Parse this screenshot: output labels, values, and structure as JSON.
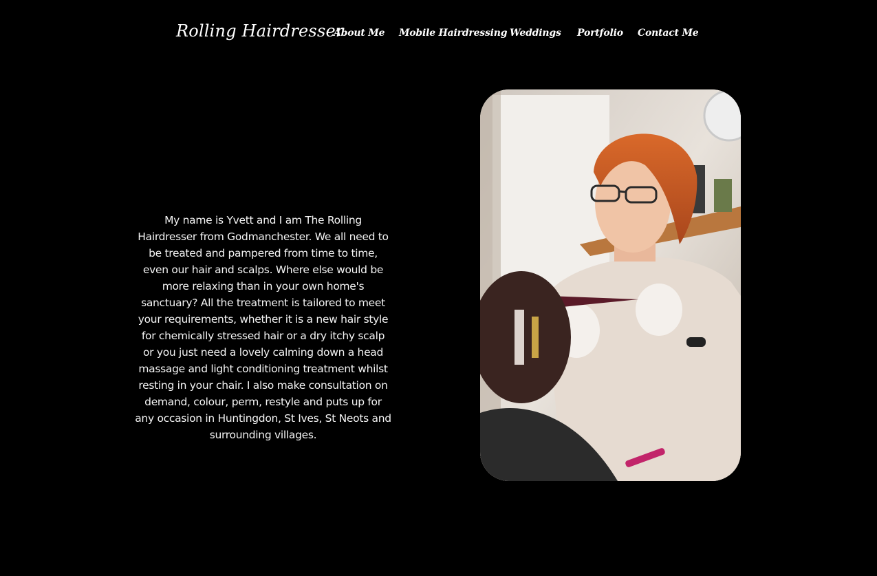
{
  "header": {
    "logo_text": "Rolling Hairdresser",
    "nav": [
      {
        "label": "About Me"
      },
      {
        "label": "Mobile Hairdressing"
      },
      {
        "label": "Weddings"
      },
      {
        "label": "Portfolio"
      },
      {
        "label": "Contact Me"
      }
    ]
  },
  "main": {
    "intro_text": "My name is Yvett and I am The Rolling Hairdresser from Godmanchester. We all need to be treated and pampered from time to time, even our hair and scalps. Where else would be more relaxing than in your own home's sanctuary? All the treatment is tailored to meet your requirements, whether it is a new hair style for chemically stressed hair or a dry itchy scalp or you just need a lovely calming down a head massage and light conditioning treatment whilst resting in your chair. I also make consultation on demand, colour, perm, restyle and puts up for any occasion in Huntingdon, St Ives, St Neots and surrounding villages."
  },
  "colors": {
    "background": "#000000",
    "text": "#ffffff"
  }
}
